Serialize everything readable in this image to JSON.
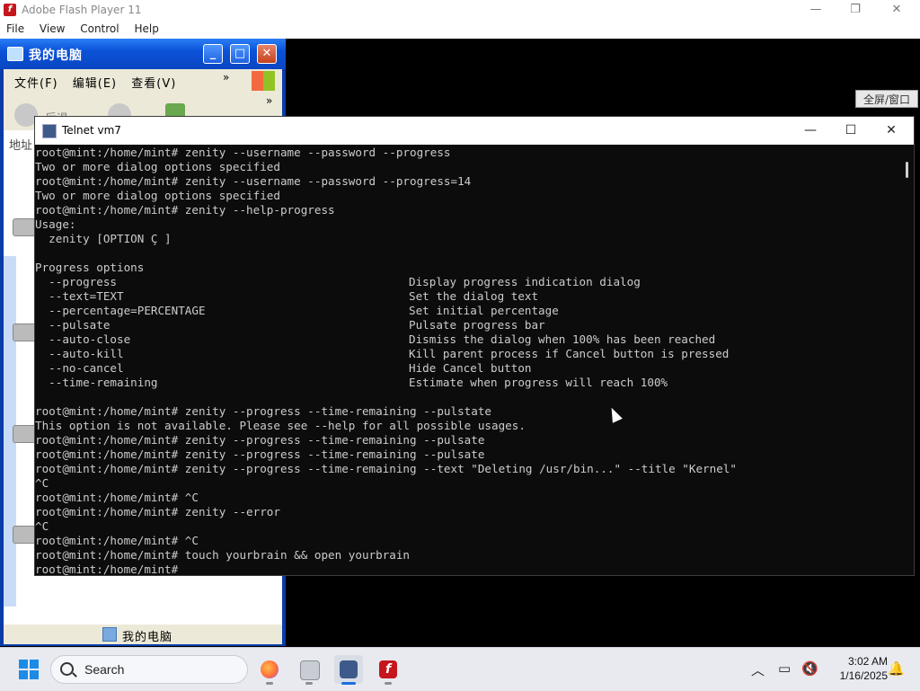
{
  "flash": {
    "title": "Adobe Flash Player 11",
    "menu": [
      "File",
      "View",
      "Control",
      "Help"
    ]
  },
  "explorer": {
    "title": "我的电脑",
    "menu": [
      "文件(F)",
      "编辑(E)",
      "查看(V)"
    ],
    "more": "»",
    "back_label": "后退",
    "address_label": "地址",
    "status_text": "我的电脑"
  },
  "fullscreen_label": "全屏/窗口",
  "telnet": {
    "title": "Telnet vm7",
    "lines": [
      "root@mint:/home/mint# zenity --username --password --progress",
      "Two or more dialog options specified",
      "root@mint:/home/mint# zenity --username --password --progress=14",
      "Two or more dialog options specified",
      "root@mint:/home/mint# zenity --help-progress",
      "Usage:",
      "  zenity [OPTION Ç ]",
      "",
      "Progress options",
      "  --progress",
      "  --text=TEXT",
      "  --percentage=PERCENTAGE",
      "  --pulsate",
      "  --auto-close",
      "  --auto-kill",
      "  --no-cancel",
      "  --time-remaining",
      "",
      "root@mint:/home/mint# zenity --progress --time-remaining --pulstate",
      "This option is not available. Please see --help for all possible usages.",
      "root@mint:/home/mint# zenity --progress --time-remaining --pulsate",
      "root@mint:/home/mint# zenity --progress --time-remaining --pulsate",
      "root@mint:/home/mint# zenity --progress --time-remaining --text \"Deleting /usr/bin...\" --title \"Kernel\"",
      "^C",
      "root@mint:/home/mint# ^C",
      "root@mint:/home/mint# zenity --error",
      "^C",
      "root@mint:/home/mint# ^C",
      "root@mint:/home/mint# touch yourbrain && open yourbrain",
      "root@mint:/home/mint#"
    ],
    "option_descriptions": [
      "Display progress indication dialog",
      "Set the dialog text",
      "Set initial percentage",
      "Pulsate progress bar",
      "Dismiss the dialog when 100% has been reached",
      "Kill parent process if Cancel button is pressed",
      "Hide Cancel button",
      "Estimate when progress will reach 100%"
    ]
  },
  "taskbar": {
    "search_label": "Search",
    "apps": [
      "firefox-icon",
      "notepad-icon",
      "telnet-icon",
      "flash-player-icon"
    ],
    "time": "3:02 AM",
    "date": "1/16/2025"
  }
}
